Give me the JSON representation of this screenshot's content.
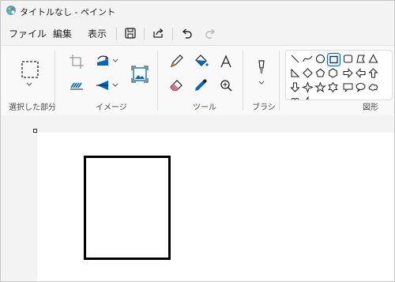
{
  "window": {
    "title": "タイトルなし - ペイント"
  },
  "menu": {
    "file": "ファイル",
    "edit": "編集",
    "view": "表示"
  },
  "toolbar": {
    "icons": [
      "save-icon",
      "share-icon",
      "undo-icon",
      "redo-icon"
    ]
  },
  "ribbon": {
    "groups": {
      "selection": "選択した部分",
      "image": "イメージ",
      "tools": "ツール",
      "brushes": "ブラシ",
      "shapes": "図形"
    },
    "shapes_selected": "rectangle"
  },
  "colors": {
    "accent": "#0067c0",
    "ribbon_bg": "#f9f9f9",
    "canvas": "#ffffff",
    "workspace": "#f3f3f3"
  }
}
